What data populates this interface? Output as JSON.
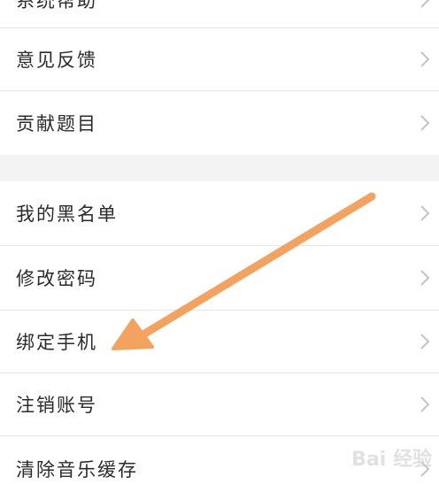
{
  "settings": {
    "items": [
      {
        "label": "系统帮助"
      },
      {
        "label": "意见反馈"
      },
      {
        "label": "贡献题目"
      },
      {
        "label": "我的黑名单"
      },
      {
        "label": "修改密码"
      },
      {
        "label": "绑定手机"
      },
      {
        "label": "注销账号"
      },
      {
        "label": "清除音乐缓存"
      }
    ]
  },
  "icons": {
    "chevron": "chevron-right-icon",
    "annotation": "orange-arrow-icon"
  },
  "colors": {
    "arrow": "#f3a35f",
    "text": "#2b2b2b",
    "chevron": "#c4c4c4",
    "divider": "#e6e6e6",
    "section_gap": "#f3f3f3"
  },
  "watermark": {
    "logo_text": "Bai 经验"
  }
}
